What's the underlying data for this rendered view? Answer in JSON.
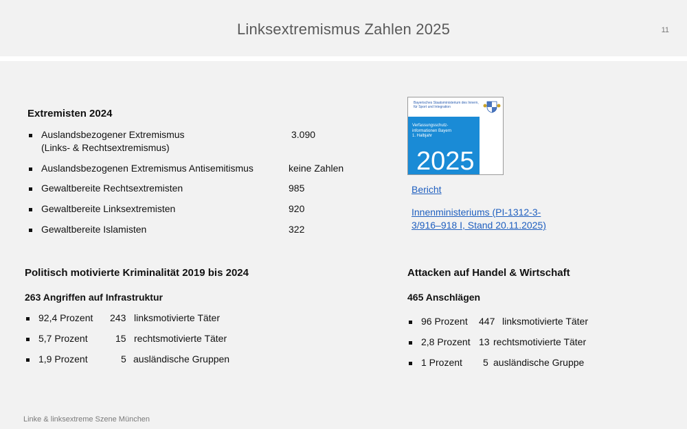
{
  "page": {
    "title": "Linksextremismus Zahlen 2025",
    "page_number": "11",
    "footer": "Linke & linksextreme Szene München"
  },
  "extremists": {
    "heading": "Extremisten 2024",
    "items": [
      {
        "label_line1": "Auslandsbezogener Extremismus",
        "label_line2": "(Links- & Rechtsextremismus)",
        "value": "3.090"
      },
      {
        "label_line1": "Auslandsbezogenen Extremismus Antisemitismus",
        "value": "keine Zahlen"
      },
      {
        "label_line1": "Gewaltbereite Rechtsextremisten",
        "value": "985"
      },
      {
        "label_line1": "Gewaltbereite Linksextremisten",
        "value": "920"
      },
      {
        "label_line1": "Gewaltbereite Islamisten",
        "value": "322"
      }
    ]
  },
  "report": {
    "cover_ministry": "Bayerisches Staatsministerium des Innern, für Sport und Integration",
    "cover_label_line1": "Verfassungsschutz-",
    "cover_label_line2": "informationen Bayern",
    "cover_label_line3": "1. Halbjahr",
    "cover_year": "2025",
    "link_bericht": "Bericht",
    "link_source_line1": "Innenministeriums (PI-1312-3-",
    "link_source_line2": "3/916–918 I, Stand 20.11.2025)"
  },
  "pmk": {
    "heading": "Politisch motivierte Kriminalität 2019 bis 2024",
    "subheading": "263 Angriffen auf Infrastruktur",
    "items": [
      {
        "percent": "92,4 Prozent",
        "count": "243",
        "label": "linksmotivierte Täter"
      },
      {
        "percent": "5,7 Prozent",
        "count": "15",
        "label": "rechtsmotivierte Täter"
      },
      {
        "percent": "1,9 Prozent",
        "count": "5",
        "label": "ausländische Gruppen"
      }
    ]
  },
  "attacks": {
    "heading": "Attacken auf Handel & Wirtschaft",
    "subheading": "465 Anschlägen",
    "items": [
      {
        "percent": "96 Prozent",
        "count": "447",
        "label": "linksmotivierte Täter"
      },
      {
        "percent": "2,8 Prozent",
        "count": "13",
        "label": "rechtsmotivierte Täter"
      },
      {
        "percent": "1 Prozent",
        "count": "5",
        "label": "ausländische Gruppe"
      }
    ]
  }
}
